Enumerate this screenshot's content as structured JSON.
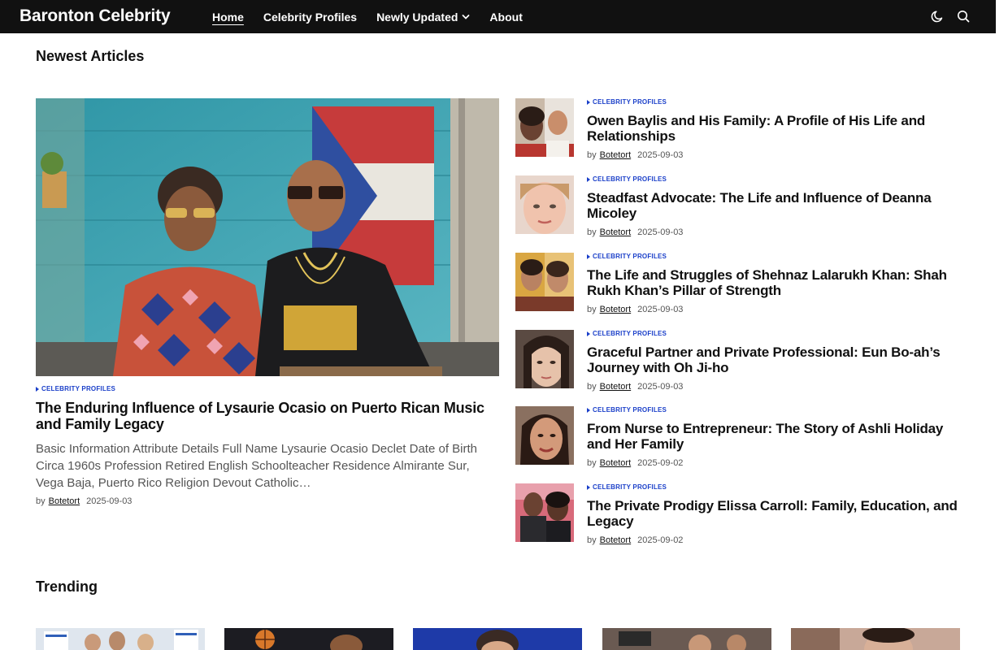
{
  "header": {
    "brand": "Baronton Celebrity",
    "nav": [
      "Home",
      "Celebrity Profiles",
      "Newly Updated",
      "About"
    ],
    "icons": [
      "moon-icon",
      "search-icon"
    ]
  },
  "newest": {
    "heading": "Newest Articles",
    "featured": {
      "category": "CELEBRITY PROFILES",
      "title": "The Enduring Influence of Lysaurie Ocasio on Puerto Rican Music and Family Legacy",
      "excerpt": "Basic Information Attribute Details Full Name Lysaurie Ocasio Declet Date of Birth Circa 1960s Profession Retired English Schoolteacher Residence Almirante Sur, Vega Baja, Puerto Rico Religion Devout Catholic…",
      "by": "by",
      "author": "Botetort",
      "date": "2025-09-03"
    },
    "list": [
      {
        "category": "CELEBRITY PROFILES",
        "title": "Owen Baylis and His Family: A Profile of His Life and Relationships",
        "by": "by",
        "author": "Botetort",
        "date": "2025-09-03"
      },
      {
        "category": "CELEBRITY PROFILES",
        "title": "Steadfast Advocate: The Life and Influence of Deanna Micoley",
        "by": "by",
        "author": "Botetort",
        "date": "2025-09-03"
      },
      {
        "category": "CELEBRITY PROFILES",
        "title": "The Life and Struggles of Shehnaz Lalarukh Khan: Shah Rukh Khan’s Pillar of Strength",
        "by": "by",
        "author": "Botetort",
        "date": "2025-09-03"
      },
      {
        "category": "CELEBRITY PROFILES",
        "title": "Graceful Partner and Private Professional: Eun Bo-ah’s Journey with Oh Ji-ho",
        "by": "by",
        "author": "Botetort",
        "date": "2025-09-03"
      },
      {
        "category": "CELEBRITY PROFILES",
        "title": "From Nurse to Entrepreneur: The Story of Ashli Holiday and Her Family",
        "by": "by",
        "author": "Botetort",
        "date": "2025-09-02"
      },
      {
        "category": "CELEBRITY PROFILES",
        "title": "The Private Prodigy Elissa Carroll: Family, Education, and Legacy",
        "by": "by",
        "author": "Botetort",
        "date": "2025-09-02"
      }
    ]
  },
  "trending": {
    "heading": "Trending"
  },
  "colors": {
    "header_bg": "#111111",
    "category_accent": "#1a3fc9",
    "text": "#111111",
    "muted": "#555555"
  }
}
